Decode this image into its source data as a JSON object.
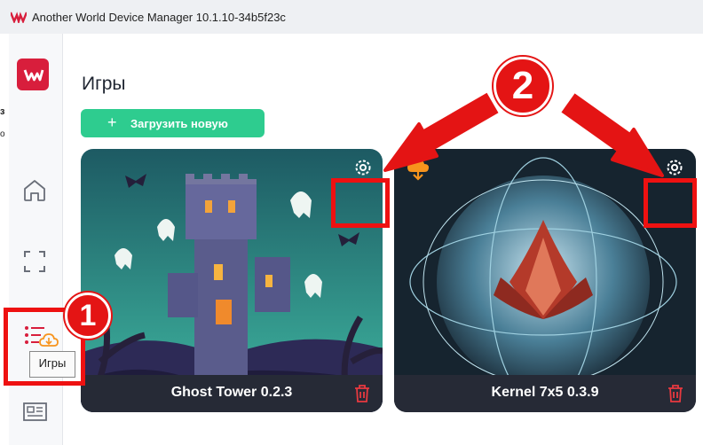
{
  "window": {
    "title": "Another World Device Manager 10.1.10-34b5f23c"
  },
  "background_window": {
    "visible_chars": [
      "з",
      "о"
    ]
  },
  "sidebar": {
    "items": [
      {
        "name": "home",
        "icon": "home-icon"
      },
      {
        "name": "screen",
        "icon": "fullscreen-icon"
      },
      {
        "name": "games",
        "icon": "list-cloud-icon",
        "tooltip": "Игры"
      },
      {
        "name": "news",
        "icon": "newspaper-icon"
      }
    ]
  },
  "main": {
    "title": "Игры",
    "upload_button": {
      "plus": "+",
      "label": "Загрузить новую"
    }
  },
  "games": [
    {
      "name": "Ghost Tower 0.2.3",
      "has_update_badge": false
    },
    {
      "name": "Kernel 7x5 0.3.9",
      "has_update_badge": true
    }
  ],
  "annotations": {
    "badge_1": "1",
    "badge_2": "2"
  },
  "colors": {
    "brand": "#d81e3c",
    "upload_button": "#2ecc8f",
    "annotation_red": "#e41414",
    "card_footer": "#262a36",
    "update_cloud": "#f7941d"
  }
}
